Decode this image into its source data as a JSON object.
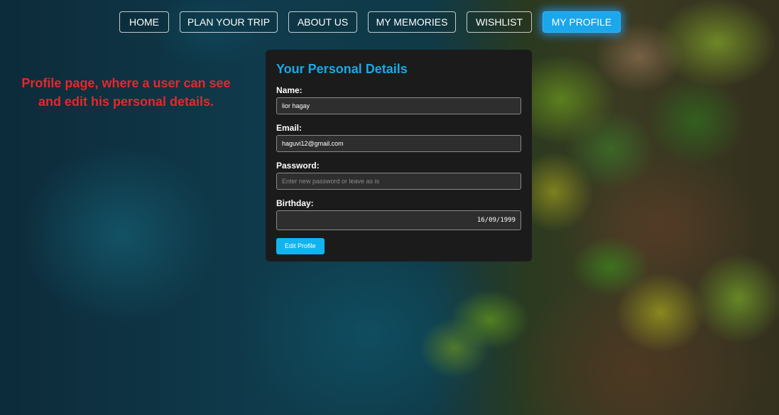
{
  "nav": {
    "items": [
      {
        "label": "HOME"
      },
      {
        "label": "PLAN YOUR TRIP"
      },
      {
        "label": "ABOUT US"
      },
      {
        "label": "MY MEMORIES"
      },
      {
        "label": "WISHLIST"
      },
      {
        "label": "MY PROFILE",
        "active": true
      }
    ]
  },
  "annotation": "Profile page, where a user can see and edit his personal details.",
  "profile": {
    "title": "Your Personal Details",
    "name_label": "Name:",
    "name_value": "lior hagay",
    "email_label": "Email:",
    "email_value": "haguvi12@gmail.com",
    "password_label": "Password:",
    "password_placeholder": "Enter new password or leave as is",
    "birthday_label": "Birthday:",
    "birthday_value": "16/09/1999",
    "edit_button": "Edit Profile"
  },
  "colors": {
    "accent": "#19a9e6",
    "annotation": "#e8262c",
    "card_bg": "#1b1b1b"
  }
}
